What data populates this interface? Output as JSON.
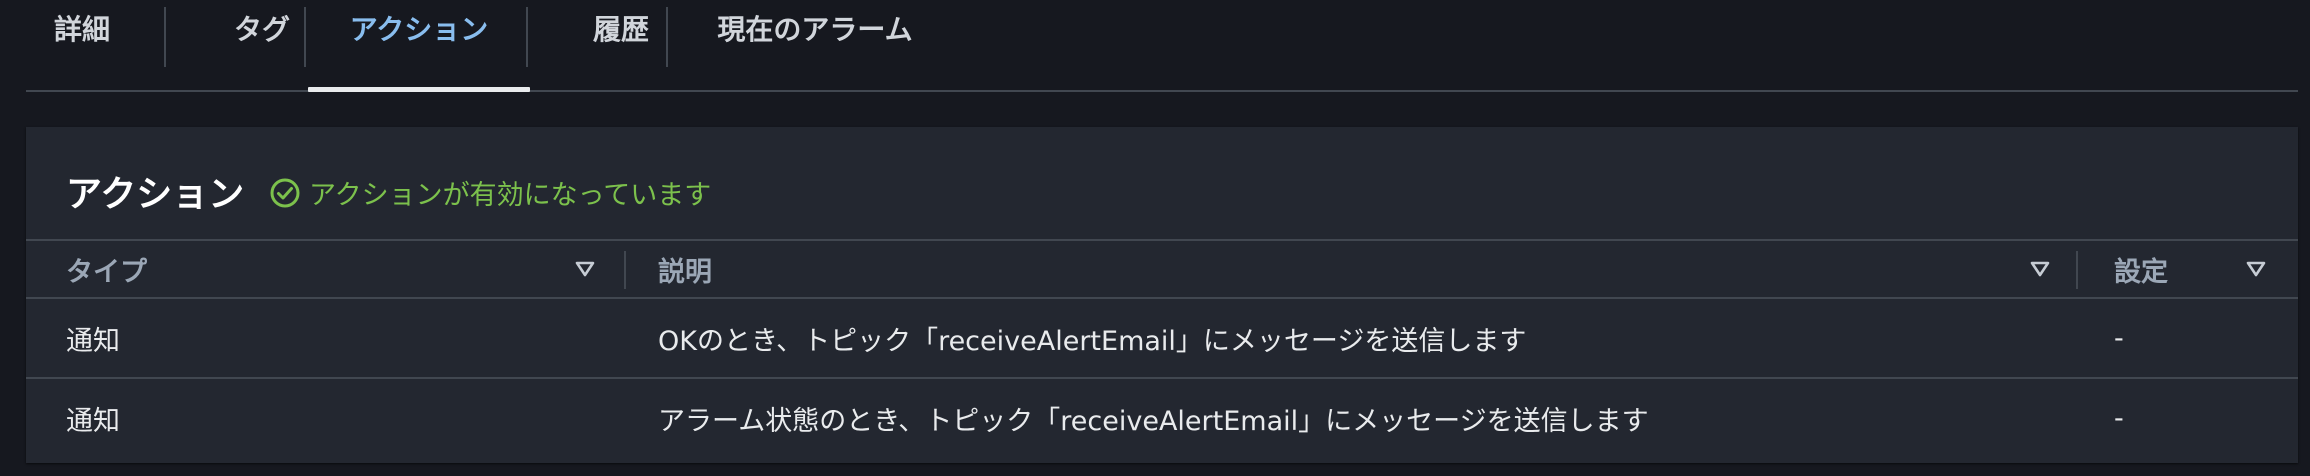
{
  "tabs": [
    {
      "label": "詳細",
      "active": false
    },
    {
      "label": "タグ",
      "active": false
    },
    {
      "label": "アクション",
      "active": true
    },
    {
      "label": "履歴",
      "active": false
    },
    {
      "label": "現在のアラーム",
      "active": false
    }
  ],
  "panel": {
    "title": "アクション",
    "status_text": "アクションが有効になっています",
    "status_icon": "check-circle-icon",
    "status_color": "#7cc14c"
  },
  "table": {
    "columns": [
      "タイプ",
      "説明",
      "設定"
    ],
    "rows": [
      {
        "type": "通知",
        "description": "OKのとき、トピック「receiveAlertEmail」にメッセージを送信します",
        "config": "-"
      },
      {
        "type": "通知",
        "description": "アラーム状態のとき、トピック「receiveAlertEmail」にメッセージを送信します",
        "config": "-"
      }
    ]
  },
  "colors": {
    "background": "#16181f",
    "panel": "#232730",
    "active_tab": "#89bdee",
    "border": "#414750"
  }
}
